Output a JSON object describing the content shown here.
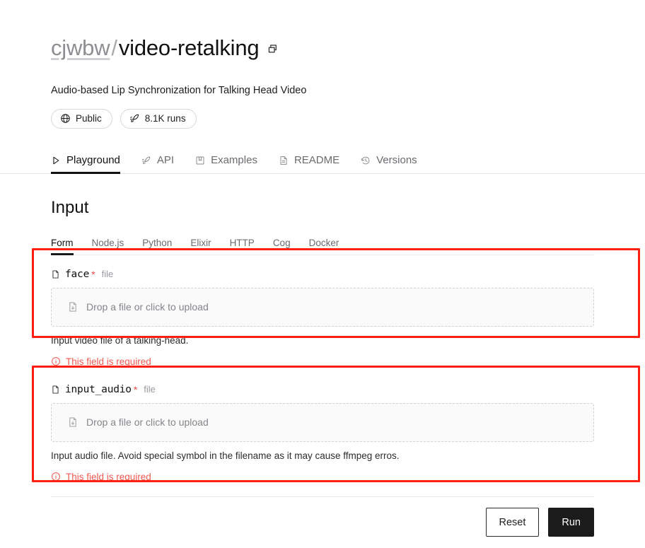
{
  "header": {
    "owner": "cjwbw",
    "separator": "/",
    "model_name": "video-retalking",
    "copy_icon": "copy-icon",
    "tagline": "Audio-based Lip Synchronization for Talking Head Video",
    "badges": [
      {
        "icon": "globe-icon",
        "label": "Public"
      },
      {
        "icon": "rocket-icon",
        "label": "8.1K runs"
      }
    ]
  },
  "nav_tabs": [
    {
      "icon": "play-icon",
      "label": "Playground",
      "active": true
    },
    {
      "icon": "rocket-icon",
      "label": "API",
      "active": false
    },
    {
      "icon": "bookmark-icon",
      "label": "Examples",
      "active": false
    },
    {
      "icon": "document-icon",
      "label": "README",
      "active": false
    },
    {
      "icon": "history-icon",
      "label": "Versions",
      "active": false
    }
  ],
  "main": {
    "section_title": "Input",
    "lang_tabs": [
      {
        "label": "Form",
        "active": true
      },
      {
        "label": "Node.js",
        "active": false
      },
      {
        "label": "Python",
        "active": false
      },
      {
        "label": "Elixir",
        "active": false
      },
      {
        "label": "HTTP",
        "active": false
      },
      {
        "label": "Cog",
        "active": false
      },
      {
        "label": "Docker",
        "active": false
      }
    ],
    "fields": [
      {
        "icon": "file-icon",
        "name": "face",
        "required_marker": "*",
        "type": "file",
        "dropzone_icon": "file-upload-icon",
        "dropzone_text": "Drop a file or click to upload",
        "help": "Input video file of a talking-head.",
        "error_icon": "info-circle-icon",
        "error": "This field is required"
      },
      {
        "icon": "file-icon",
        "name": "input_audio",
        "required_marker": "*",
        "type": "file",
        "dropzone_icon": "file-upload-icon",
        "dropzone_text": "Drop a file or click to upload",
        "help": "Input audio file. Avoid special symbol in the filename as it may cause ffmpeg erros.",
        "error_icon": "info-circle-icon",
        "error": "This field is required"
      }
    ]
  },
  "footer": {
    "reset_label": "Reset",
    "run_label": "Run"
  },
  "colors": {
    "annotation_red": "#fc2013",
    "error_red": "#ef5a50",
    "required_star_red": "#e8493f",
    "run_button_bg": "#1b1b1b",
    "muted_text": "#6b6b70"
  }
}
